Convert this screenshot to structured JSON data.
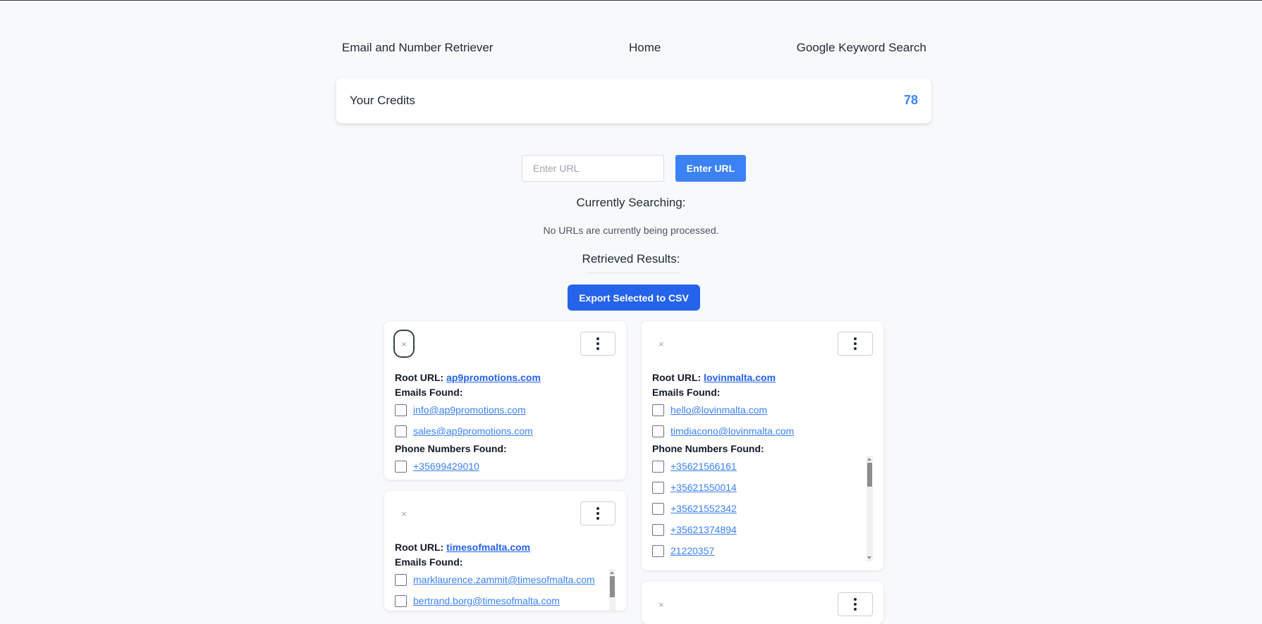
{
  "nav": {
    "left": "Email and Number Retriever",
    "center": "Home",
    "right": "Google Keyword Search"
  },
  "credits": {
    "label": "Your Credits",
    "value": "78"
  },
  "search": {
    "placeholder": "Enter URL",
    "button": "Enter URL"
  },
  "currently_searching": {
    "heading": "Currently Searching:",
    "status": "No URLs are currently being processed."
  },
  "results": {
    "heading": "Retrieved Results:",
    "export_button": "Export Selected to CSV",
    "root_label": "Root URL:",
    "emails_label": "Emails Found:",
    "phones_label": "Phone Numbers Found:",
    "close_glyph": "×",
    "cards": [
      {
        "root_url": "ap9promotions.com",
        "emails": [
          "info@ap9promotions.com",
          "sales@ap9promotions.com"
        ],
        "phones": [
          "+35699429010"
        ]
      },
      {
        "root_url": "lovinmalta.com",
        "emails": [
          "hello@lovinmalta.com",
          "timdiacono@lovinmalta.com"
        ],
        "phones": [
          "+35621566161",
          "+35621550014",
          "+35621552342",
          "+35621374894",
          "21220357"
        ]
      },
      {
        "root_url": "timesofmalta.com",
        "emails": [
          "marklaurence.zammit@timesofmalta.com",
          "bertrand.borg@timesofmalta.com"
        ],
        "phones": []
      }
    ]
  }
}
